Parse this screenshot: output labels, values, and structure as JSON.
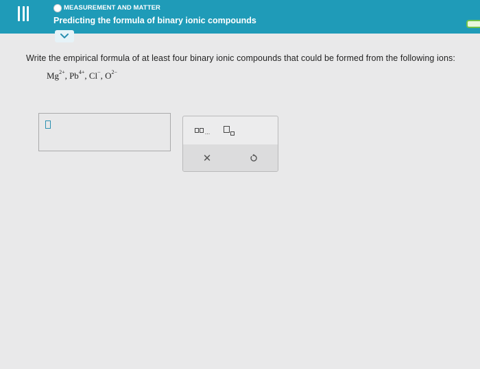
{
  "header": {
    "topic": "MEASUREMENT AND MATTER",
    "title": "Predicting the formula of binary ionic compounds"
  },
  "question": {
    "prompt": "Write the empirical formula of at least four binary ionic compounds that could be formed from the following ions:",
    "ions": [
      {
        "symbol": "Mg",
        "charge": "2+",
        "sep": ", "
      },
      {
        "symbol": "Pb",
        "charge": "4+",
        "sep": ", "
      },
      {
        "symbol": "Cl",
        "charge": "−",
        "sep": ", "
      },
      {
        "symbol": "O",
        "charge": "2−",
        "sep": ""
      }
    ]
  },
  "palette": {
    "formula_ellipsis": "...",
    "clear_symbol": "✕"
  },
  "colors": {
    "header": "#1f9bb8",
    "accent": "#2a8fb0",
    "progress": "#6fc24a"
  },
  "icons": [
    "menu-icon",
    "status-dot-icon",
    "chevron-down-icon",
    "formula-template-icon",
    "subscript-template-icon",
    "clear-icon",
    "undo-icon"
  ]
}
